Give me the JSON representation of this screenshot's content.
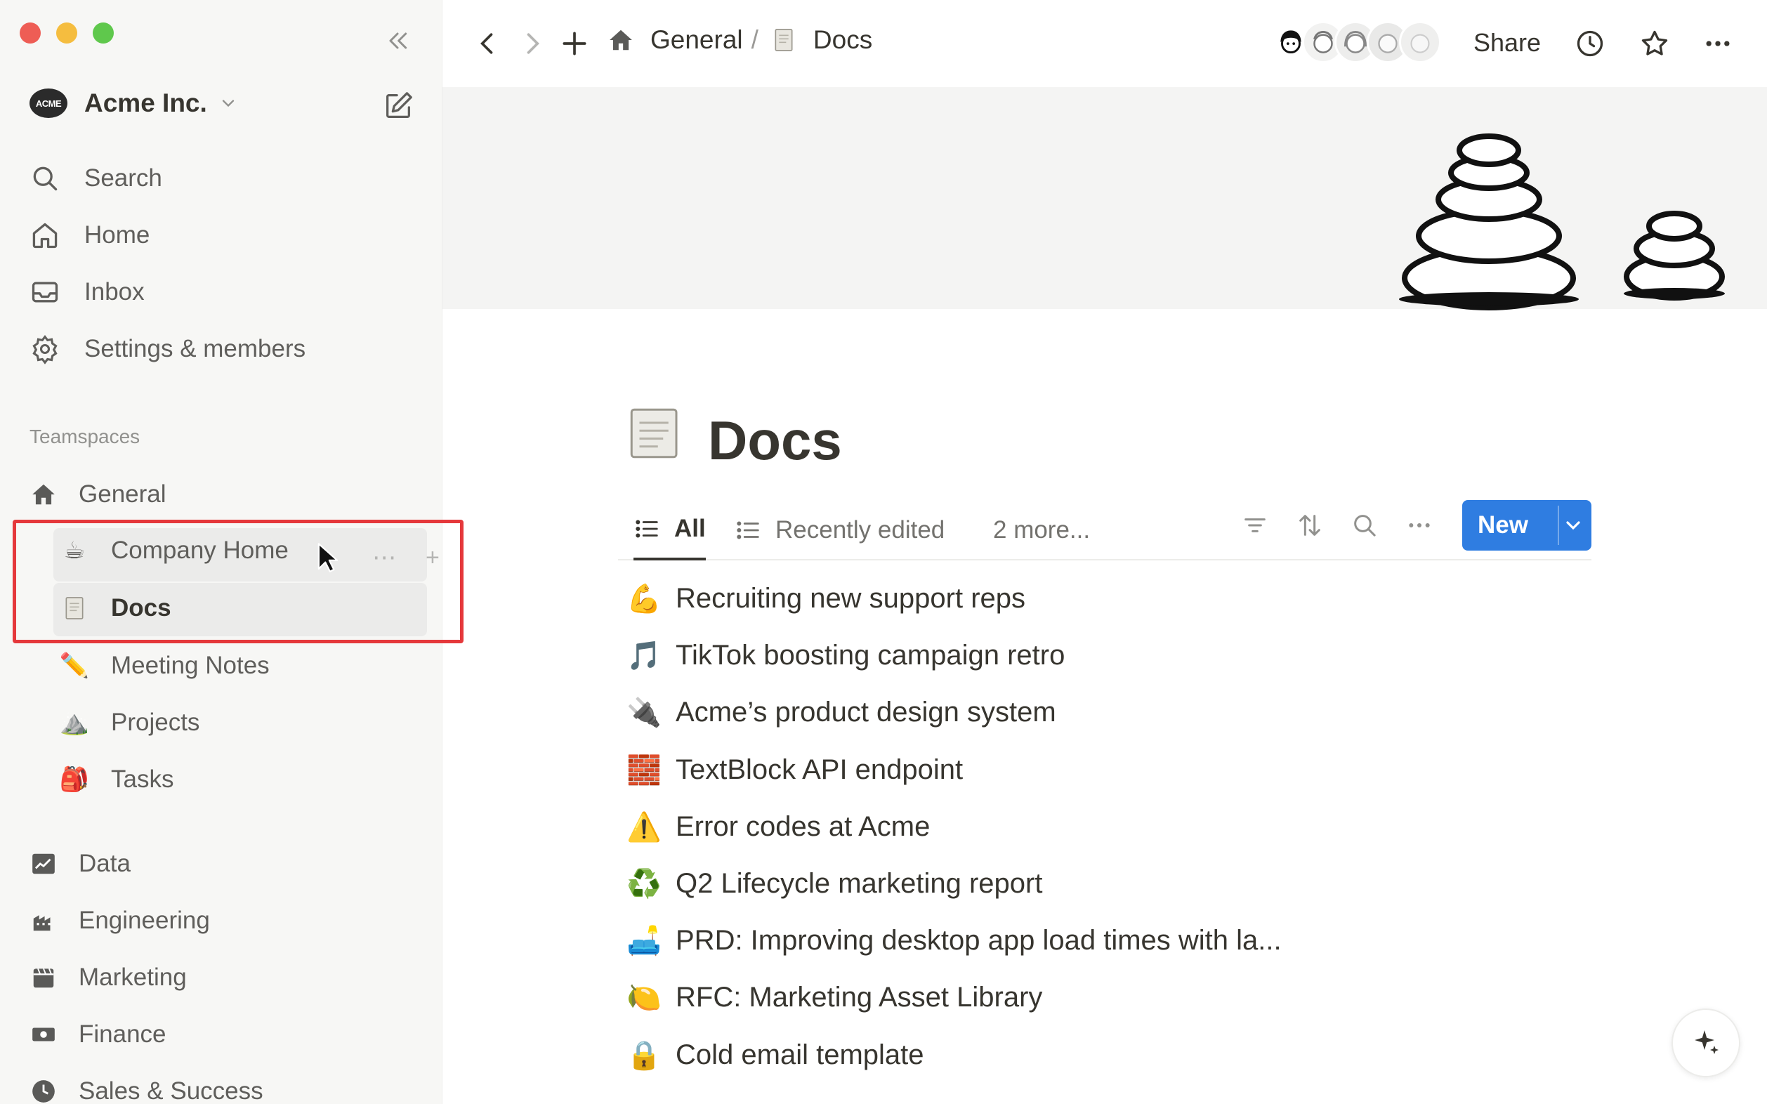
{
  "sidebar": {
    "workspace": {
      "logo_text": "ACME",
      "name": "Acme Inc."
    },
    "nav": [
      {
        "label": "Search",
        "icon": "search-icon"
      },
      {
        "label": "Home",
        "icon": "home-icon"
      },
      {
        "label": "Inbox",
        "icon": "inbox-icon"
      },
      {
        "label": "Settings & members",
        "icon": "gear-icon"
      }
    ],
    "teamspaces_label": "Teamspaces",
    "tree": [
      {
        "label": "General",
        "icon": "house-icon",
        "emoji": "🏠"
      },
      {
        "label": "Company Home",
        "icon": "coffee-icon",
        "emoji": "☕"
      },
      {
        "label": "Docs",
        "icon": "scroll-icon",
        "emoji": "📜"
      },
      {
        "label": "Meeting Notes",
        "icon": "pencil-icon",
        "emoji": "✏️"
      },
      {
        "label": "Projects",
        "icon": "mountain-icon",
        "emoji": "⛰️"
      },
      {
        "label": "Tasks",
        "icon": "backpack-icon",
        "emoji": "🎒"
      },
      {
        "label": "Data",
        "icon": "chart-icon",
        "emoji": "📈"
      },
      {
        "label": "Engineering",
        "icon": "building-icon",
        "emoji": "🏗️"
      },
      {
        "label": "Marketing",
        "icon": "clapper-icon",
        "emoji": "🎬"
      },
      {
        "label": "Finance",
        "icon": "money-icon",
        "emoji": "💵"
      },
      {
        "label": "Sales & Success",
        "icon": "clock-icon",
        "emoji": "🕒"
      }
    ]
  },
  "topbar": {
    "breadcrumb": [
      {
        "label": "General",
        "icon": "house-icon"
      },
      {
        "label": "Docs",
        "icon": "scroll-icon"
      }
    ],
    "breadcrumb_separator": "/",
    "share_label": "Share"
  },
  "page": {
    "icon": "scroll-icon",
    "title": "Docs",
    "views": [
      {
        "label": "All",
        "icon": "list-icon",
        "active": true
      },
      {
        "label": "Recently edited",
        "icon": "list-icon",
        "active": false
      },
      {
        "label": "2 more...",
        "icon": "",
        "active": false
      }
    ],
    "new_button_label": "New",
    "docs": [
      {
        "emoji": "💪",
        "title": "Recruiting new support reps"
      },
      {
        "emoji": "🎵",
        "title": "TikTok boosting campaign retro"
      },
      {
        "emoji": "🔌",
        "title": "Acme’s product design system"
      },
      {
        "emoji": "🧱",
        "title": "TextBlock API endpoint"
      },
      {
        "emoji": "⚠️",
        "title": "Error codes at Acme"
      },
      {
        "emoji": "♻️",
        "title": "Q2 Lifecycle marketing report"
      },
      {
        "emoji": "🛋️",
        "title": "PRD: Improving desktop app load times with la..."
      },
      {
        "emoji": "🍋",
        "title": "RFC: Marketing Asset Library"
      },
      {
        "emoji": "🔒",
        "title": "Cold email template"
      }
    ]
  },
  "colors": {
    "accent": "#2f7de1",
    "highlight_border": "#e5383b",
    "sidebar_bg": "#f7f7f5"
  }
}
